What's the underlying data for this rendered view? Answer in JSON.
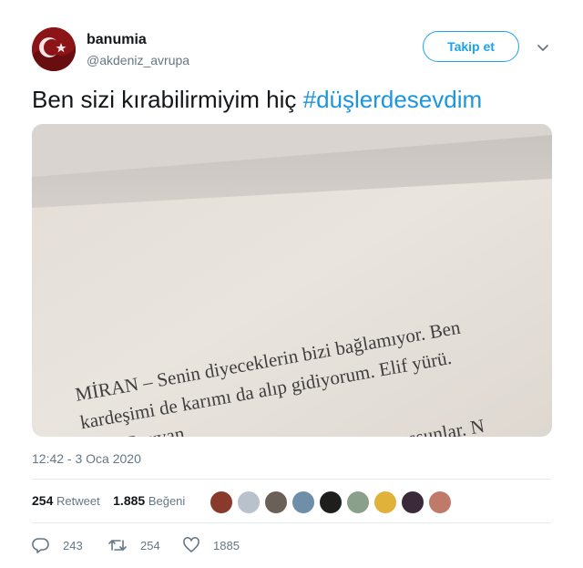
{
  "author": {
    "name": "banumia",
    "handle": "@akdeniz_avrupa"
  },
  "follow_label": "Takip et",
  "tweet": {
    "text": "Ben sizi kırabilirmiyim hiç ",
    "hashtag": "#düşlerdesevdim"
  },
  "photo": {
    "lines": [
      "MİRAN – Senin diyeceklerin bizi bağlamıyor. Ben",
      "kardeşimi de karımı da alıp gidiyorum. Elif yürü.",
      "Hadi Reyyan.",
      "ver  konuşsunlar. N"
    ]
  },
  "timestamp": "12:42 - 3 Oca 2020",
  "stats": {
    "retweet_count": "254",
    "retweet_label": "Retweet",
    "like_count": "1.885",
    "like_label": "Beğeni"
  },
  "actions": {
    "reply_count": "243",
    "retweet_count": "254",
    "like_count": "1885"
  },
  "colors": {
    "accent": "#1da1f2",
    "hashtag": "#1b95e0",
    "muted": "#657786"
  }
}
